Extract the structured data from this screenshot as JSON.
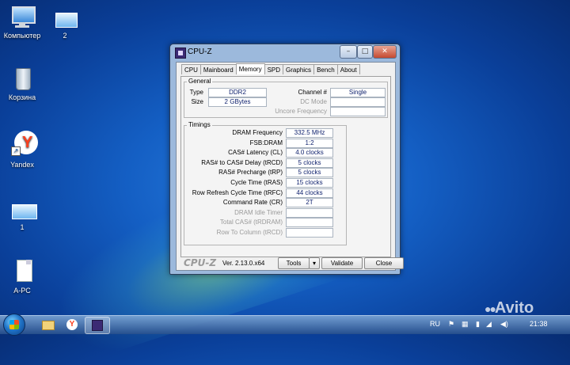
{
  "desktop": {
    "icons": [
      {
        "label": "Компьютер"
      },
      {
        "label": "2"
      },
      {
        "label": "Корзина"
      },
      {
        "label": "Yandex"
      },
      {
        "label": "1"
      },
      {
        "label": "A-PC"
      }
    ]
  },
  "window": {
    "title": "CPU-Z",
    "tabs": [
      "CPU",
      "Mainboard",
      "Memory",
      "SPD",
      "Graphics",
      "Bench",
      "About"
    ],
    "active_tab": "Memory",
    "general": {
      "title": "General",
      "type_label": "Type",
      "type_value": "DDR2",
      "size_label": "Size",
      "size_value": "2 GBytes",
      "channel_label": "Channel #",
      "channel_value": "Single",
      "dc_mode_label": "DC Mode",
      "dc_mode_value": "",
      "uncore_label": "Uncore Frequency",
      "uncore_value": ""
    },
    "timings": {
      "title": "Timings",
      "rows": [
        {
          "label": "DRAM Frequency",
          "value": "332.5 MHz",
          "enabled": true
        },
        {
          "label": "FSB:DRAM",
          "value": "1:2",
          "enabled": true
        },
        {
          "label": "CAS# Latency (CL)",
          "value": "4.0 clocks",
          "enabled": true
        },
        {
          "label": "RAS# to CAS# Delay (tRCD)",
          "value": "5 clocks",
          "enabled": true
        },
        {
          "label": "RAS# Precharge (tRP)",
          "value": "5 clocks",
          "enabled": true
        },
        {
          "label": "Cycle Time (tRAS)",
          "value": "15 clocks",
          "enabled": true
        },
        {
          "label": "Row Refresh Cycle Time (tRFC)",
          "value": "44 clocks",
          "enabled": true
        },
        {
          "label": "Command Rate (CR)",
          "value": "2T",
          "enabled": true
        },
        {
          "label": "DRAM Idle Timer",
          "value": "",
          "enabled": false
        },
        {
          "label": "Total CAS# (tRDRAM)",
          "value": "",
          "enabled": false
        },
        {
          "label": "Row To Column (tRCD)",
          "value": "",
          "enabled": false
        }
      ]
    },
    "footer": {
      "brand": "CPU-Z",
      "version": "Ver. 2.13.0.x64",
      "tools_label": "Tools",
      "validate_label": "Validate",
      "close_label": "Close"
    }
  },
  "taskbar": {
    "language": "RU",
    "clock": "21:38"
  },
  "watermark": "Avito"
}
